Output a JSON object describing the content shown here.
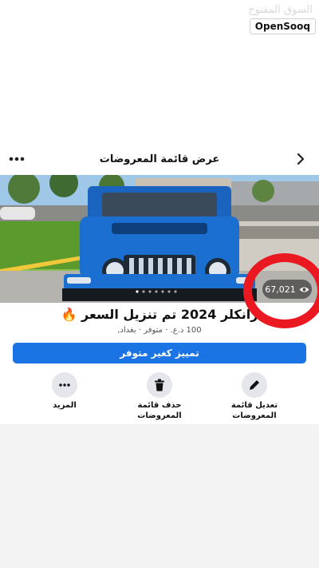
{
  "watermark": {
    "arabic": "السوق المفتوح",
    "english": "OpenSooq"
  },
  "header": {
    "title": "عرض قائمة المعروضات",
    "back_icon": "chevron-left-icon",
    "more_icon": "more-horizontal-icon"
  },
  "listing": {
    "views": "67,021",
    "title": "رانكلر 2024 تم تنزيل السعر 🔥",
    "subtitle": "100 د.ع. · متوفر · بغداد,"
  },
  "primary_action": {
    "label": "تمييز كغير متوفر"
  },
  "actions": [
    {
      "icon": "pencil-icon",
      "label_line1": "تعديل قائمة",
      "label_line2": "المعروضات"
    },
    {
      "icon": "trash-icon",
      "label_line1": "حذف قائمة",
      "label_line2": "المعروضات"
    },
    {
      "icon": "more-horizontal-icon",
      "label_line1": "المزيد",
      "label_line2": ""
    }
  ],
  "colors": {
    "accent": "#1b74e4",
    "highlight_ring": "#ea1820",
    "vehicle": "#1b6fd1",
    "action_circle": "#e4e6eb"
  }
}
